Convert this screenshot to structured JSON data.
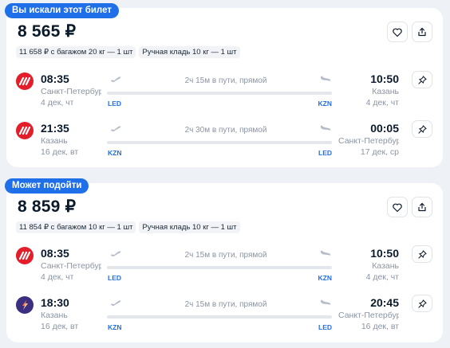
{
  "offers": [
    {
      "badge": "Вы искали этот билет",
      "price": "8 565 ₽",
      "chips": [
        "11 658 ₽ с багажом 20 кг — 1 шт",
        "Ручная кладь 10 кг — 1 шт"
      ],
      "segments": [
        {
          "airline_logo": "nordwind-logo",
          "dep_time": "08:35",
          "dep_city": "Санкт-Петербург",
          "dep_date": "4 дек, чт",
          "duration": "2ч 15м в пути, прямой",
          "from_code": "LED",
          "to_code": "KZN",
          "arr_time": "10:50",
          "arr_city": "Казань",
          "arr_date": "4 дек, чт"
        },
        {
          "airline_logo": "nordwind-logo",
          "dep_time": "21:35",
          "dep_city": "Казань",
          "dep_date": "16 дек, вт",
          "duration": "2ч 30м в пути, прямой",
          "from_code": "KZN",
          "to_code": "LED",
          "arr_time": "00:05",
          "arr_city": "Санкт-Петербург",
          "arr_date": "17 дек, ср"
        }
      ]
    },
    {
      "badge": "Может подойти",
      "price": "8 859 ₽",
      "chips": [
        "11 854 ₽ с багажом 10 кг — 1 шт",
        "Ручная кладь 10 кг — 1 шт"
      ],
      "segments": [
        {
          "airline_logo": "nordwind-logo",
          "dep_time": "08:35",
          "dep_city": "Санкт-Петербург",
          "dep_date": "4 дек, чт",
          "duration": "2ч 15м в пути, прямой",
          "from_code": "LED",
          "to_code": "KZN",
          "arr_time": "10:50",
          "arr_city": "Казань",
          "arr_date": "4 дек, чт"
        },
        {
          "airline_logo": "smartavia-logo",
          "dep_time": "18:30",
          "dep_city": "Казань",
          "dep_date": "16 дек, вт",
          "duration": "2ч 15м в пути, прямой",
          "from_code": "KZN",
          "to_code": "LED",
          "arr_time": "20:45",
          "arr_city": "Санкт-Петербург",
          "arr_date": "16 дек, вт"
        }
      ]
    }
  ],
  "icons": {
    "favorite": "heart-icon",
    "share": "share-icon",
    "pin": "pin-icon",
    "takeoff": "plane-takeoff-icon",
    "landing": "plane-landing-icon"
  },
  "colors": {
    "accent": "#1f6fe8",
    "nordwind": "#e31e2a",
    "smartavia": "#3b2f80",
    "muted_text": "#8a94a3",
    "background": "#eef1f5"
  }
}
